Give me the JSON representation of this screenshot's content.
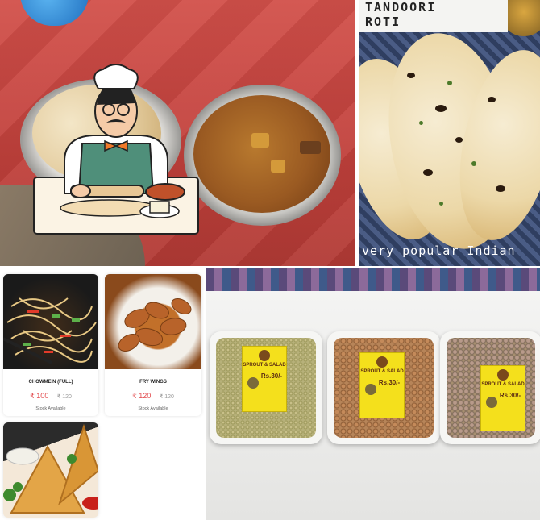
{
  "tiles": {
    "curry_photo": {
      "alt": "Curry and roti on steel plates"
    },
    "roti_photo": {
      "title_line1": "TANDOORI",
      "title_line2": "ROTI",
      "caption": "very popular Indian"
    },
    "menu": {
      "items": [
        {
          "name": "CHOWMEIN (FULL)",
          "price": "₹ 100",
          "original_price": "₹ 120",
          "stock": "Stock Available"
        },
        {
          "name": "FRY WINGS",
          "price": "₹ 120",
          "original_price": "₹ 120",
          "stock": "Stock Available"
        }
      ]
    },
    "sprouts_photo": {
      "trays": [
        {
          "heading": "SPROUT & SALAD",
          "price": "Rs.30/-"
        },
        {
          "heading": "SPROUT & SALAD",
          "price": "Rs.30/-"
        },
        {
          "heading": "SPROUT & SALAD",
          "price": "Rs.30/-"
        }
      ]
    }
  }
}
